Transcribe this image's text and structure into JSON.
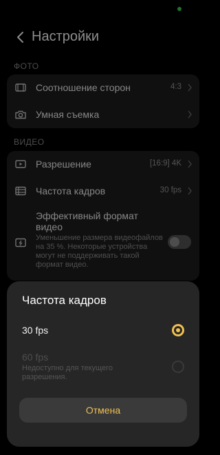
{
  "header": {
    "title": "Настройки"
  },
  "photo": {
    "section": "ФОТО",
    "rows": [
      {
        "label": "Соотношение сторон",
        "value": "4:3"
      },
      {
        "label": "Умная съемка",
        "value": ""
      }
    ]
  },
  "video": {
    "section": "ВИДЕО",
    "rows": [
      {
        "label": "Разрешение",
        "value": "[16:9] 4K"
      },
      {
        "label": "Частота кадров",
        "value": "30 fps"
      }
    ],
    "efficient": {
      "label": "Эффективный формат видео",
      "desc": "Уменьшение размера видеофайлов на 35 %. Некоторые устройства могут не поддерживать такой формат видео.",
      "enabled": false
    }
  },
  "sheet": {
    "title": "Частота кадров",
    "options": [
      {
        "label": "30 fps",
        "desc": "",
        "selected": true,
        "enabled": true
      },
      {
        "label": "60 fps",
        "desc": "Недоступно для текущего разрешения.",
        "selected": false,
        "enabled": false
      }
    ],
    "cancel_label": "Отмена"
  },
  "colors": {
    "accent": "#f0c052",
    "background": "#000000",
    "card": "#1e1e1e",
    "sheet": "#262626"
  }
}
